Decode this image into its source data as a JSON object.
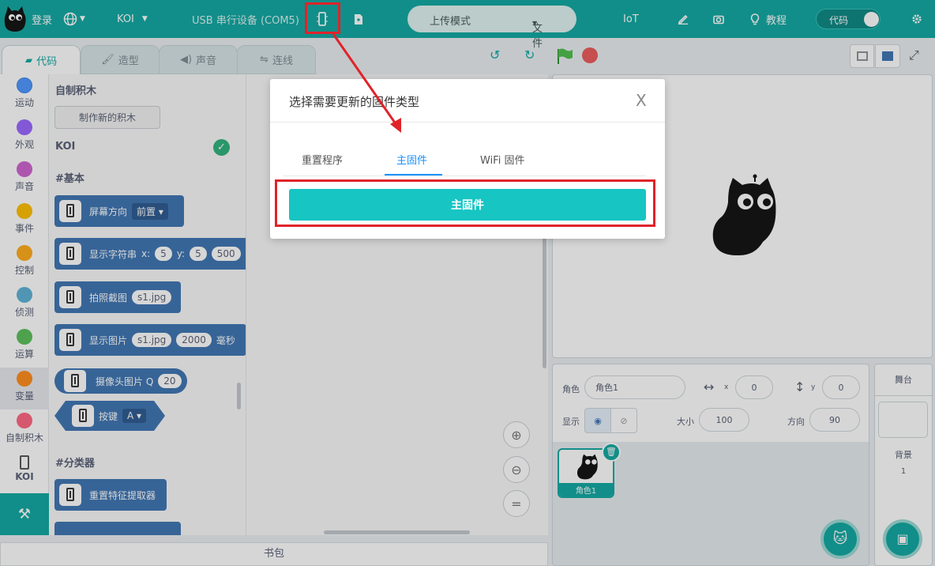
{
  "topbar": {
    "login": "登录",
    "device": "KOI",
    "serial": "USB 串行设备 (COM5)",
    "mode": "上传模式",
    "file": "文件",
    "iot": "IoT",
    "tutorial": "教程",
    "code_toggle": "代码"
  },
  "tabs": [
    {
      "label": "代码"
    },
    {
      "label": "造型"
    },
    {
      "label": "声音"
    },
    {
      "label": "连线"
    }
  ],
  "categories": [
    {
      "label": "运动",
      "color": "#4c97ff"
    },
    {
      "label": "外观",
      "color": "#9966ff"
    },
    {
      "label": "声音",
      "color": "#cf63cf"
    },
    {
      "label": "事件",
      "color": "#ffbf00"
    },
    {
      "label": "控制",
      "color": "#ffab19"
    },
    {
      "label": "侦测",
      "color": "#5cb1d6"
    },
    {
      "label": "运算",
      "color": "#59c059"
    },
    {
      "label": "变量",
      "color": "#ff8c1a"
    },
    {
      "label": "自制积木",
      "color": "#ff6680"
    },
    {
      "label": "KOI",
      "color": ""
    }
  ],
  "palette": {
    "custom_heading": "自制积木",
    "make_block": "制作新的积木",
    "koi_heading": "KOI",
    "basic_heading": "#基本",
    "classifier_heading": "#分类器",
    "blocks": {
      "screen_dir": "屏幕方向",
      "screen_dir_val": "前置",
      "show_text": "显示字符串",
      "x_label": "x:",
      "x_val": "5",
      "y_label": "y:",
      "y_val": "5",
      "extra_val": "500",
      "snapshot": "拍照截图",
      "snapshot_file": "s1.jpg",
      "show_image": "显示图片",
      "show_image_file": "s1.jpg",
      "show_image_ms": "2000",
      "ms_label": "毫秒",
      "camera": "摄像头图片 Q",
      "camera_val": "20",
      "button": "按键",
      "button_val": "A",
      "reset_feature": "重置特征提取器"
    }
  },
  "bag": "书包",
  "sprite": {
    "label_role": "角色",
    "name": "角色1",
    "x_label": "x",
    "x": "0",
    "y_label": "y",
    "y": "0",
    "show_label": "显示",
    "size_label": "大小",
    "size": "100",
    "dir_label": "方向",
    "direction": "90",
    "thumb_name": "角色1"
  },
  "stage_panel": {
    "title": "舞台",
    "backdrop_label": "背景",
    "backdrop_count": "1"
  },
  "modal": {
    "title": "选择需要更新的固件类型",
    "close": "X",
    "tabs": [
      "重置程序",
      "主固件",
      "WiFi 固件"
    ],
    "button": "主固件"
  }
}
